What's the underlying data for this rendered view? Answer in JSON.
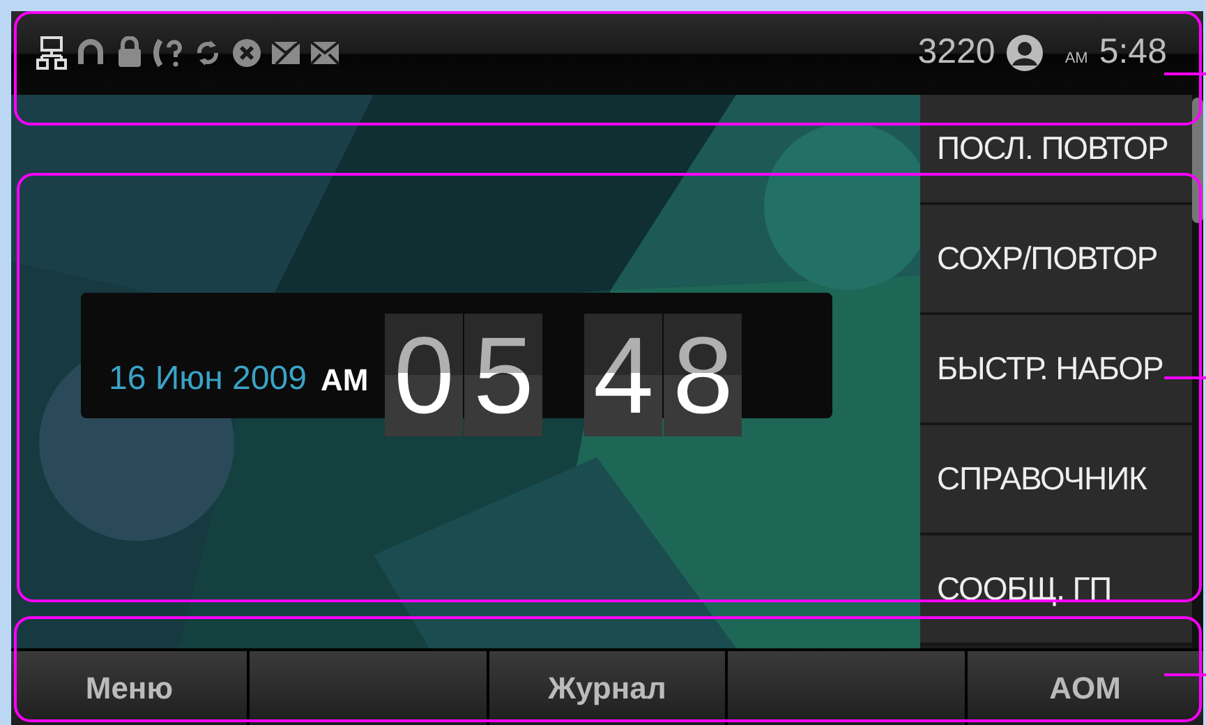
{
  "status_bar": {
    "extension": "3220",
    "meridiem": "AM",
    "time": "5:48"
  },
  "clock": {
    "date": "16 Июн 2009",
    "meridiem": "AM",
    "hours": [
      "0",
      "5"
    ],
    "minutes": [
      "4",
      "8"
    ]
  },
  "line_keys": [
    {
      "label": "ПОСЛ. ПОВТОР"
    },
    {
      "label": "СОХР/ПОВТОР"
    },
    {
      "label": "БЫСТР. НАБОР"
    },
    {
      "label": "СПРАВОЧНИК"
    },
    {
      "label": "СООБЩ. ГП"
    }
  ],
  "softkeys": [
    {
      "kind": "labeled",
      "label": "Меню"
    },
    {
      "kind": "blank"
    },
    {
      "kind": "labeled",
      "label": "Журнал"
    },
    {
      "kind": "blank"
    },
    {
      "kind": "labeled",
      "label": "AOM"
    }
  ]
}
